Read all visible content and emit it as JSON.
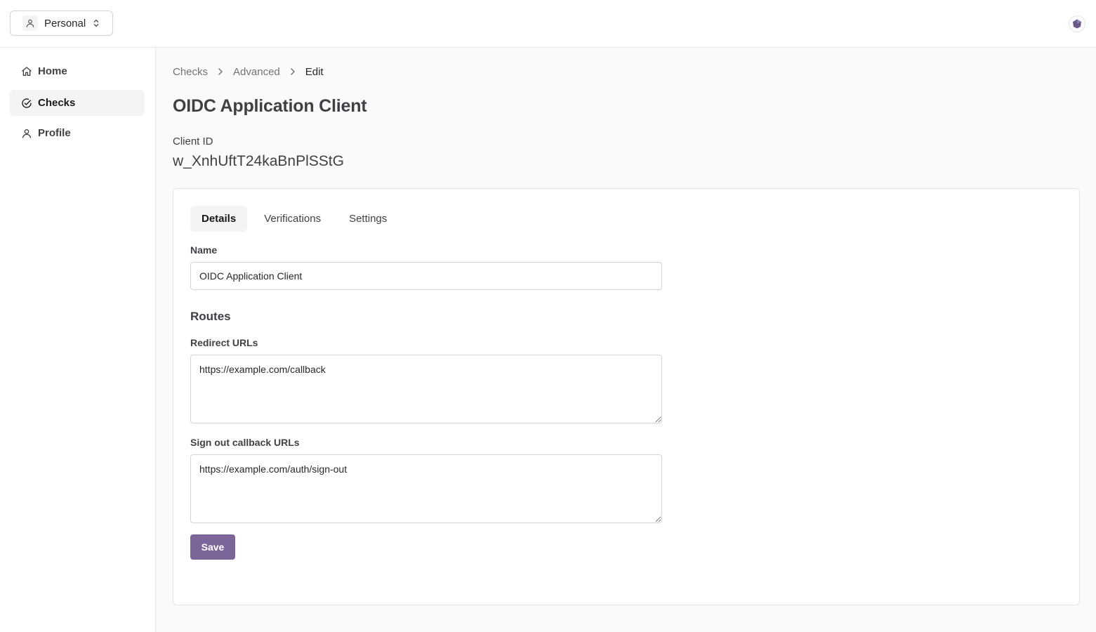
{
  "header": {
    "account": {
      "label": "Personal",
      "icon": "user-icon",
      "chevron": "chevron-updown-icon"
    },
    "user_avatar": {
      "icon": "avatar-icon",
      "color": "#6b5a88"
    }
  },
  "sidebar": {
    "items": [
      {
        "label": "Home",
        "icon": "home-icon",
        "active": false
      },
      {
        "label": "Checks",
        "icon": "check-circle-icon",
        "active": true
      },
      {
        "label": "Profile",
        "icon": "user-icon",
        "active": false
      }
    ]
  },
  "breadcrumb": {
    "items": [
      "Checks",
      "Advanced"
    ],
    "current": "Edit"
  },
  "page": {
    "title": "OIDC Application Client",
    "client_id_label": "Client ID",
    "client_id_value": "w_XnhUftT24kaBnPlSStG"
  },
  "tabs": [
    {
      "label": "Details",
      "active": true
    },
    {
      "label": "Verifications",
      "active": false
    },
    {
      "label": "Settings",
      "active": false
    }
  ],
  "form": {
    "name_label": "Name",
    "name_value": "OIDC Application Client",
    "routes_title": "Routes",
    "redirect_label": "Redirect URLs",
    "redirect_value": "https://example.com/callback",
    "signout_label": "Sign out callback URLs",
    "signout_value": "https://example.com/auth/sign-out",
    "save_label": "Save"
  },
  "colors": {
    "accent": "#7c6699",
    "border": "#e4e4e7",
    "active_bg": "#f4f4f5"
  }
}
